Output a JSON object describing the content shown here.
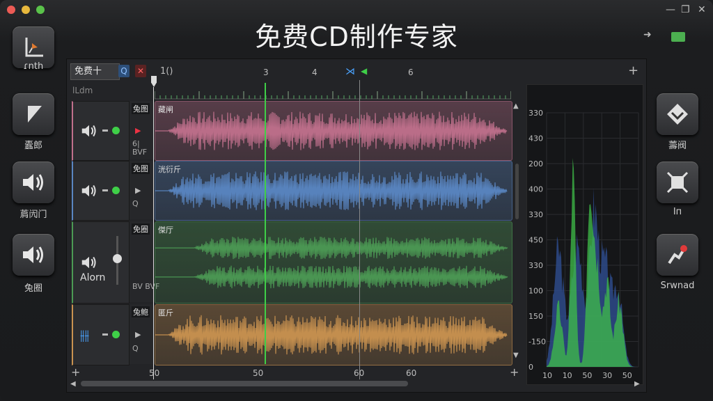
{
  "window": {
    "title": "免费CD制作专家"
  },
  "left_sidebar": [
    {
      "label": "ɾnth"
    },
    {
      "label": "蠹郎"
    },
    {
      "label": "菺闶门"
    },
    {
      "label": "兔圈"
    }
  ],
  "right_sidebar": [
    {
      "label": "薵阀"
    },
    {
      "label": "Iп"
    },
    {
      "label": "Srwnad"
    }
  ],
  "toolbar": {
    "dropdown": "免费十",
    "field": "1()"
  },
  "ruler": {
    "label": "lLdm",
    "marks": [
      "3",
      "4",
      "6"
    ],
    "bottom_marks": [
      "50",
      "50",
      "60",
      "60"
    ]
  },
  "tracks": [
    {
      "tag": "兔图",
      "name": "藏闸",
      "color": "#c0708c",
      "side": "6|\nBVF"
    },
    {
      "tag": "免图",
      "name": "洸衍斤",
      "color": "#5a86c2",
      "side": "Q"
    },
    {
      "tag": "免圈",
      "name": "傑厅",
      "color": "#4c9a54",
      "side": "BV BVF",
      "vol_label": "Alorn"
    },
    {
      "tag": "兔鲍",
      "name": "匿斤",
      "color": "#c99250",
      "side": "Q"
    }
  ],
  "spectrum": {
    "y_labels": [
      "330",
      "430",
      "200",
      "400",
      "330",
      "450",
      "330",
      "100",
      "150",
      "-150",
      "0"
    ],
    "x_labels": [
      "10",
      "10",
      "50",
      "30",
      "50"
    ]
  },
  "colors": {
    "green": "#3fcf48",
    "pink": "#c0708c",
    "blue": "#5a86c2",
    "green_track": "#4c9a54",
    "orange": "#c99250"
  }
}
